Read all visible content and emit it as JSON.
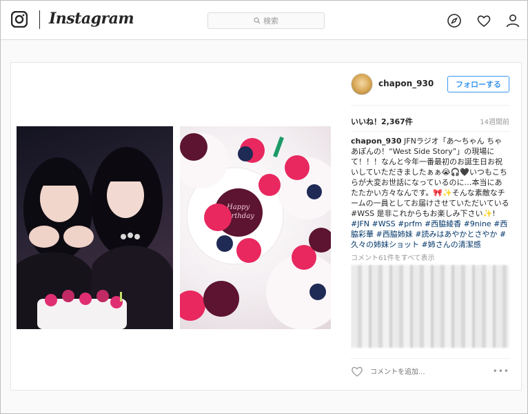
{
  "nav": {
    "brand": "Instagram",
    "search_placeholder": "検索"
  },
  "post": {
    "username": "chapon_930",
    "follow_label": "フォローする",
    "likes": "いいね！2,367件",
    "time_ago": "14週間前",
    "caption_user": "chapon_930",
    "caption_text": "JFNラジオ「あ〜ちゃん ちゃあぽんの！“West Side Story”」の現場にて！！！なんと今年一番最初のお誕生日お祝いしていただきましたぁぁ😭🎧🖤いつもこちらが大変お世話になっているのに…本当にあたたかい方々なんです。🎀✨そんな素敵なチームの一員としてお届けさせていただいている",
    "caption_tail": "#WSS 是非これからもお楽しみ下さい✨!",
    "hashtags": "#JFN #WSS #prfm #西脇綾香 #9nine #西脇彩華 #西脇姉妹 #読みはあやかとさやか #久々の姉妹ショット #姉さんの清潔感",
    "view_all_comments": "コメント61件をすべて表示",
    "comment_placeholder": "コメントを追加...",
    "more_label": "•••"
  },
  "icons": [
    "instagram-logo-icon",
    "search-icon",
    "compass-icon",
    "heart-icon",
    "profile-icon",
    "scroll-up-icon",
    "scroll-down-icon",
    "like-icon",
    "more-options-icon"
  ],
  "colors": {
    "accent": "#3897f0",
    "hashtag": "#003569",
    "muted": "#999999"
  }
}
